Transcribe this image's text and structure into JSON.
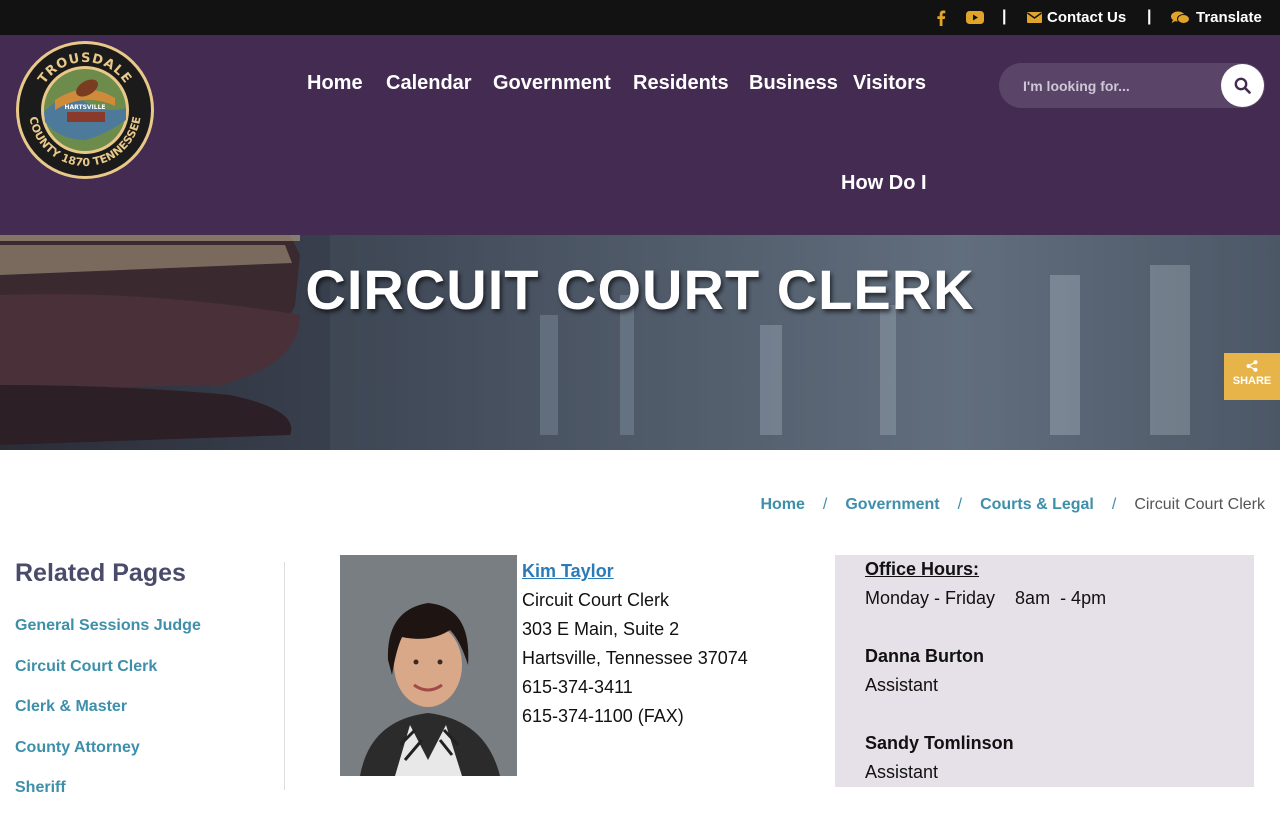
{
  "topbar": {
    "facebook_icon": "facebook-icon",
    "youtube_icon": "youtube-icon",
    "contact_label": "Contact Us",
    "translate_label": "Translate",
    "separator": "|",
    "accent_color": "#e0a42a"
  },
  "header": {
    "seal_top_text": "TROUSDALE",
    "seal_bottom_text": "COUNTY 1870 TENNESSEE",
    "seal_center_text": "HARTSVILLE",
    "nav": [
      "Home",
      "Calendar",
      "Government",
      "Residents",
      "Business",
      "Visitors",
      "How Do I"
    ],
    "search_placeholder": "I'm looking for...",
    "background_color": "#432b52"
  },
  "banner": {
    "title": "CIRCUIT COURT CLERK",
    "share_label": "SHARE"
  },
  "breadcrumb": {
    "items": [
      "Home",
      "Government",
      "Courts & Legal"
    ],
    "current": "Circuit Court Clerk",
    "separator": "/"
  },
  "sidebar": {
    "title": "Related Pages",
    "items": [
      "General Sessions Judge",
      "Circuit Court Clerk",
      "Clerk & Master",
      "County Attorney",
      "Sheriff"
    ]
  },
  "contact": {
    "name": "Kim Taylor",
    "title": "Circuit Court Clerk",
    "address1": "303 E Main, Suite 2",
    "address2": "Hartsville, Tennessee 37074",
    "phone": "615-374-3411",
    "fax": "615-374-1100 (FAX)"
  },
  "hours": {
    "label": "Office Hours:",
    "schedule": "Monday - Friday    8am  - 4pm",
    "staff": [
      {
        "name": "Danna Burton",
        "role": "Assistant"
      },
      {
        "name": "Sandy Tomlinson",
        "role": "Assistant"
      }
    ]
  }
}
